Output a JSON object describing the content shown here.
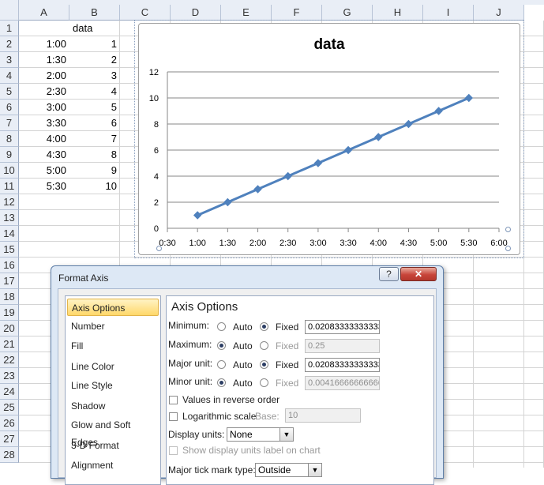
{
  "sheet": {
    "columns": [
      "A",
      "B",
      "C",
      "D",
      "E",
      "F",
      "G",
      "H",
      "I",
      "J"
    ],
    "rows": [
      "1",
      "2",
      "3",
      "4",
      "5",
      "6",
      "7",
      "8",
      "9",
      "10",
      "11",
      "12",
      "13",
      "14",
      "15",
      "16",
      "17",
      "18",
      "19",
      "20",
      "21",
      "22",
      "23",
      "24",
      "25",
      "26",
      "27",
      "28"
    ],
    "header_b1": "data",
    "col_a": [
      "1:00",
      "1:30",
      "2:00",
      "2:30",
      "3:00",
      "3:30",
      "4:00",
      "4:30",
      "5:00",
      "5:30"
    ],
    "col_b": [
      "1",
      "2",
      "3",
      "4",
      "5",
      "6",
      "7",
      "8",
      "9",
      "10"
    ]
  },
  "chart_data": {
    "type": "line",
    "title": "data",
    "x": [
      "1:00",
      "1:30",
      "2:00",
      "2:30",
      "3:00",
      "3:30",
      "4:00",
      "4:30",
      "5:00",
      "5:30"
    ],
    "series": [
      {
        "values": [
          1,
          2,
          3,
          4,
          5,
          6,
          7,
          8,
          9,
          10
        ],
        "color": "#4f81bd"
      }
    ],
    "x_ticks": [
      "0:30",
      "1:00",
      "1:30",
      "2:00",
      "2:30",
      "3:00",
      "3:30",
      "4:00",
      "4:30",
      "5:00",
      "5:30",
      "6:00"
    ],
    "y_ticks": [
      "0",
      "2",
      "4",
      "6",
      "8",
      "10",
      "12"
    ],
    "ylim": [
      0,
      12
    ],
    "xlim": [
      "0:30",
      "6:00"
    ],
    "grid": true,
    "legend": "none"
  },
  "dialog": {
    "title": "Format Axis",
    "help_label": "?",
    "close_label": "✕",
    "nav": [
      "Axis Options",
      "Number",
      "Fill",
      "Line Color",
      "Line Style",
      "Shadow",
      "Glow and Soft Edges",
      "3-D Format",
      "Alignment"
    ],
    "panel_title": "Axis Options",
    "minimum_label": "Minimum:",
    "maximum_label": "Maximum:",
    "major_label": "Major unit:",
    "minor_label": "Minor unit:",
    "auto": "Auto",
    "fixed": "Fixed",
    "minimum_value": "0.0208333333333333",
    "maximum_value": "0.25",
    "major_value": "0.0208333333333333",
    "minor_value": "0.00416666666666667",
    "reverse_label": "Values in reverse order",
    "log_label": "Logarithmic scale",
    "base_label": "Base:",
    "base_value": "10",
    "display_units_label": "Display units:",
    "display_units_value": "None",
    "show_units_label": "Show display units label on chart",
    "major_tick_label": "Major tick mark type:",
    "major_tick_value": "Outside"
  }
}
